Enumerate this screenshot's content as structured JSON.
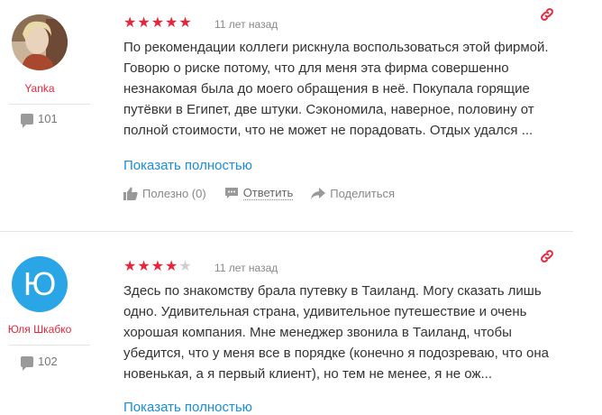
{
  "reviews": [
    {
      "author": "Yanka",
      "review_count": "101",
      "rating": 5,
      "stars": "★★★★★",
      "stars_empty": "",
      "date": "11 лет назад",
      "text": "По рекомендации коллеги рискнула воспользоваться этой фирмой. Говорю о риске потому, что для меня эта фирма совершенно незнакомая была до моего обращения в неё. Покупала горящие путёвки в Египет, две штуки. Сэкономила, наверное, половину от полной стоимости, что не может не порадовать. Отдых удался ...",
      "show_more": "Показать полностью",
      "helpful": "Полезно (0)",
      "reply": "Ответить",
      "share": "Поделиться"
    },
    {
      "author": "Юля Шкабко",
      "avatar_letter": "Ю",
      "review_count": "102",
      "rating": 4,
      "stars": "★★★★",
      "stars_empty": "★",
      "date": "11 лет назад",
      "text": "Здесь по знакомству брала путевку в Таиланд. Могу сказать лишь одно. Удивительная страна, удивительное путешествие и очень хорошая компания. Мне менеджер звонила в Таиланд, чтобы убедится, что у меня все в порядке (конечно я подозреваю, что она новенькая, а я первый клиент), но тем не менее, я не ож...",
      "show_more": "Показать полностью"
    }
  ],
  "colors": {
    "accent": "#e8263a",
    "link": "#1a8ed8",
    "avatar_bg": "#2aa6e6"
  },
  "icons": [
    "link-icon",
    "thumb-up-icon",
    "comment-icon",
    "share-icon",
    "comments-count-icon"
  ]
}
